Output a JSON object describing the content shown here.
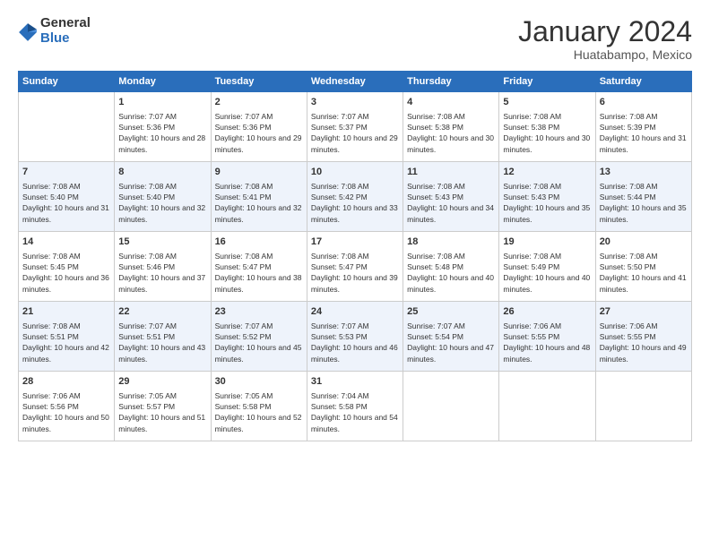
{
  "logo": {
    "general": "General",
    "blue": "Blue"
  },
  "header": {
    "title": "January 2024",
    "location": "Huatabampo, Mexico"
  },
  "weekdays": [
    "Sunday",
    "Monday",
    "Tuesday",
    "Wednesday",
    "Thursday",
    "Friday",
    "Saturday"
  ],
  "weeks": [
    [
      {
        "day": "",
        "sunrise": "",
        "sunset": "",
        "daylight": ""
      },
      {
        "day": "1",
        "sunrise": "Sunrise: 7:07 AM",
        "sunset": "Sunset: 5:36 PM",
        "daylight": "Daylight: 10 hours and 28 minutes."
      },
      {
        "day": "2",
        "sunrise": "Sunrise: 7:07 AM",
        "sunset": "Sunset: 5:36 PM",
        "daylight": "Daylight: 10 hours and 29 minutes."
      },
      {
        "day": "3",
        "sunrise": "Sunrise: 7:07 AM",
        "sunset": "Sunset: 5:37 PM",
        "daylight": "Daylight: 10 hours and 29 minutes."
      },
      {
        "day": "4",
        "sunrise": "Sunrise: 7:08 AM",
        "sunset": "Sunset: 5:38 PM",
        "daylight": "Daylight: 10 hours and 30 minutes."
      },
      {
        "day": "5",
        "sunrise": "Sunrise: 7:08 AM",
        "sunset": "Sunset: 5:38 PM",
        "daylight": "Daylight: 10 hours and 30 minutes."
      },
      {
        "day": "6",
        "sunrise": "Sunrise: 7:08 AM",
        "sunset": "Sunset: 5:39 PM",
        "daylight": "Daylight: 10 hours and 31 minutes."
      }
    ],
    [
      {
        "day": "7",
        "sunrise": "Sunrise: 7:08 AM",
        "sunset": "Sunset: 5:40 PM",
        "daylight": "Daylight: 10 hours and 31 minutes."
      },
      {
        "day": "8",
        "sunrise": "Sunrise: 7:08 AM",
        "sunset": "Sunset: 5:40 PM",
        "daylight": "Daylight: 10 hours and 32 minutes."
      },
      {
        "day": "9",
        "sunrise": "Sunrise: 7:08 AM",
        "sunset": "Sunset: 5:41 PM",
        "daylight": "Daylight: 10 hours and 32 minutes."
      },
      {
        "day": "10",
        "sunrise": "Sunrise: 7:08 AM",
        "sunset": "Sunset: 5:42 PM",
        "daylight": "Daylight: 10 hours and 33 minutes."
      },
      {
        "day": "11",
        "sunrise": "Sunrise: 7:08 AM",
        "sunset": "Sunset: 5:43 PM",
        "daylight": "Daylight: 10 hours and 34 minutes."
      },
      {
        "day": "12",
        "sunrise": "Sunrise: 7:08 AM",
        "sunset": "Sunset: 5:43 PM",
        "daylight": "Daylight: 10 hours and 35 minutes."
      },
      {
        "day": "13",
        "sunrise": "Sunrise: 7:08 AM",
        "sunset": "Sunset: 5:44 PM",
        "daylight": "Daylight: 10 hours and 35 minutes."
      }
    ],
    [
      {
        "day": "14",
        "sunrise": "Sunrise: 7:08 AM",
        "sunset": "Sunset: 5:45 PM",
        "daylight": "Daylight: 10 hours and 36 minutes."
      },
      {
        "day": "15",
        "sunrise": "Sunrise: 7:08 AM",
        "sunset": "Sunset: 5:46 PM",
        "daylight": "Daylight: 10 hours and 37 minutes."
      },
      {
        "day": "16",
        "sunrise": "Sunrise: 7:08 AM",
        "sunset": "Sunset: 5:47 PM",
        "daylight": "Daylight: 10 hours and 38 minutes."
      },
      {
        "day": "17",
        "sunrise": "Sunrise: 7:08 AM",
        "sunset": "Sunset: 5:47 PM",
        "daylight": "Daylight: 10 hours and 39 minutes."
      },
      {
        "day": "18",
        "sunrise": "Sunrise: 7:08 AM",
        "sunset": "Sunset: 5:48 PM",
        "daylight": "Daylight: 10 hours and 40 minutes."
      },
      {
        "day": "19",
        "sunrise": "Sunrise: 7:08 AM",
        "sunset": "Sunset: 5:49 PM",
        "daylight": "Daylight: 10 hours and 40 minutes."
      },
      {
        "day": "20",
        "sunrise": "Sunrise: 7:08 AM",
        "sunset": "Sunset: 5:50 PM",
        "daylight": "Daylight: 10 hours and 41 minutes."
      }
    ],
    [
      {
        "day": "21",
        "sunrise": "Sunrise: 7:08 AM",
        "sunset": "Sunset: 5:51 PM",
        "daylight": "Daylight: 10 hours and 42 minutes."
      },
      {
        "day": "22",
        "sunrise": "Sunrise: 7:07 AM",
        "sunset": "Sunset: 5:51 PM",
        "daylight": "Daylight: 10 hours and 43 minutes."
      },
      {
        "day": "23",
        "sunrise": "Sunrise: 7:07 AM",
        "sunset": "Sunset: 5:52 PM",
        "daylight": "Daylight: 10 hours and 45 minutes."
      },
      {
        "day": "24",
        "sunrise": "Sunrise: 7:07 AM",
        "sunset": "Sunset: 5:53 PM",
        "daylight": "Daylight: 10 hours and 46 minutes."
      },
      {
        "day": "25",
        "sunrise": "Sunrise: 7:07 AM",
        "sunset": "Sunset: 5:54 PM",
        "daylight": "Daylight: 10 hours and 47 minutes."
      },
      {
        "day": "26",
        "sunrise": "Sunrise: 7:06 AM",
        "sunset": "Sunset: 5:55 PM",
        "daylight": "Daylight: 10 hours and 48 minutes."
      },
      {
        "day": "27",
        "sunrise": "Sunrise: 7:06 AM",
        "sunset": "Sunset: 5:55 PM",
        "daylight": "Daylight: 10 hours and 49 minutes."
      }
    ],
    [
      {
        "day": "28",
        "sunrise": "Sunrise: 7:06 AM",
        "sunset": "Sunset: 5:56 PM",
        "daylight": "Daylight: 10 hours and 50 minutes."
      },
      {
        "day": "29",
        "sunrise": "Sunrise: 7:05 AM",
        "sunset": "Sunset: 5:57 PM",
        "daylight": "Daylight: 10 hours and 51 minutes."
      },
      {
        "day": "30",
        "sunrise": "Sunrise: 7:05 AM",
        "sunset": "Sunset: 5:58 PM",
        "daylight": "Daylight: 10 hours and 52 minutes."
      },
      {
        "day": "31",
        "sunrise": "Sunrise: 7:04 AM",
        "sunset": "Sunset: 5:58 PM",
        "daylight": "Daylight: 10 hours and 54 minutes."
      },
      {
        "day": "",
        "sunrise": "",
        "sunset": "",
        "daylight": ""
      },
      {
        "day": "",
        "sunrise": "",
        "sunset": "",
        "daylight": ""
      },
      {
        "day": "",
        "sunrise": "",
        "sunset": "",
        "daylight": ""
      }
    ]
  ]
}
